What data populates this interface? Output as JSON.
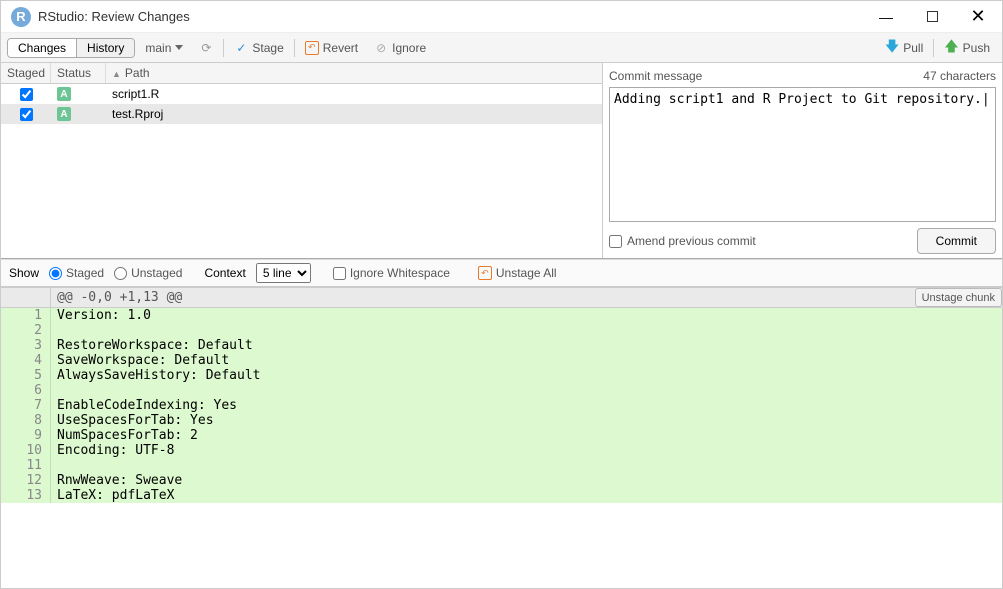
{
  "window": {
    "title": "RStudio: Review Changes"
  },
  "toolbar": {
    "tabs": {
      "changes": "Changes",
      "history": "History"
    },
    "branch": "main",
    "stage": "Stage",
    "revert": "Revert",
    "ignore": "Ignore",
    "pull": "Pull",
    "push": "Push"
  },
  "filelist": {
    "headers": {
      "staged": "Staged",
      "status": "Status",
      "path": "Path"
    },
    "rows": [
      {
        "staged": true,
        "status": "A",
        "path": "script1.R",
        "selected": false
      },
      {
        "staged": true,
        "status": "A",
        "path": "test.Rproj",
        "selected": true
      }
    ]
  },
  "commit": {
    "label": "Commit message",
    "count_label": "47 characters",
    "message": "Adding script1 and R Project to Git repository.",
    "amend": "Amend previous commit",
    "button": "Commit"
  },
  "difftoolbar": {
    "show": "Show",
    "staged": "Staged",
    "unstaged": "Unstaged",
    "context": "Context",
    "context_value": "5 line",
    "ignore_ws": "Ignore Whitespace",
    "unstage_all": "Unstage All"
  },
  "diff": {
    "hunk": "@@ -0,0 +1,13 @@",
    "unstage_chunk": "Unstage chunk",
    "lines": [
      {
        "n": 1,
        "t": "Version: 1.0"
      },
      {
        "n": 2,
        "t": ""
      },
      {
        "n": 3,
        "t": "RestoreWorkspace: Default"
      },
      {
        "n": 4,
        "t": "SaveWorkspace: Default"
      },
      {
        "n": 5,
        "t": "AlwaysSaveHistory: Default"
      },
      {
        "n": 6,
        "t": ""
      },
      {
        "n": 7,
        "t": "EnableCodeIndexing: Yes"
      },
      {
        "n": 8,
        "t": "UseSpacesForTab: Yes"
      },
      {
        "n": 9,
        "t": "NumSpacesForTab: 2"
      },
      {
        "n": 10,
        "t": "Encoding: UTF-8"
      },
      {
        "n": 11,
        "t": ""
      },
      {
        "n": 12,
        "t": "RnwWeave: Sweave"
      },
      {
        "n": 13,
        "t": "LaTeX: pdfLaTeX"
      }
    ]
  }
}
